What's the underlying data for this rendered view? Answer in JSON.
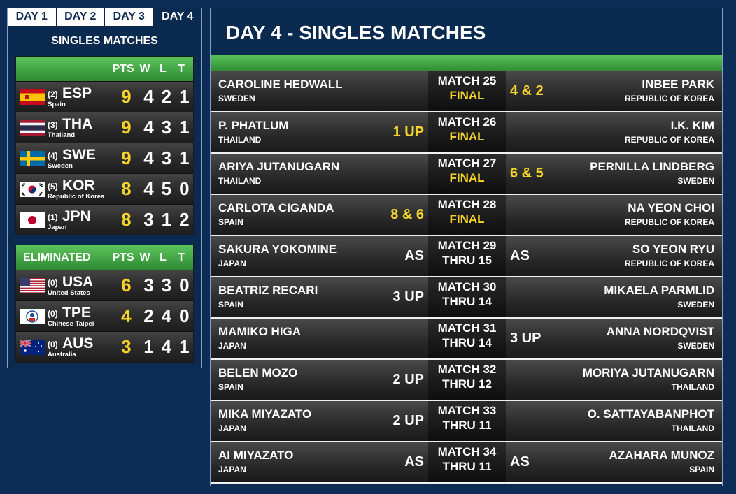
{
  "day_tabs": [
    {
      "label": "DAY 1",
      "active": false
    },
    {
      "label": "DAY 2",
      "active": false
    },
    {
      "label": "DAY 3",
      "active": false
    },
    {
      "label": "DAY 4",
      "active": true
    }
  ],
  "left_heading": "SINGLES MATCHES",
  "standings_header": {
    "label": "",
    "pts": "PTS",
    "w": "W",
    "l": "L",
    "t": "T"
  },
  "standings": [
    {
      "seed": "(2)",
      "abbr": "ESP",
      "country": "Spain",
      "pts": "9",
      "w": "4",
      "l": "2",
      "t": "1",
      "flag": "spain-flag"
    },
    {
      "seed": "(3)",
      "abbr": "THA",
      "country": "Thailand",
      "pts": "9",
      "w": "4",
      "l": "3",
      "t": "1",
      "flag": "thailand-flag"
    },
    {
      "seed": "(4)",
      "abbr": "SWE",
      "country": "Sweden",
      "pts": "9",
      "w": "4",
      "l": "3",
      "t": "1",
      "flag": "sweden-flag"
    },
    {
      "seed": "(5)",
      "abbr": "KOR",
      "country": "Republic of Korea",
      "pts": "8",
      "w": "4",
      "l": "5",
      "t": "0",
      "flag": "korea-flag"
    },
    {
      "seed": "(1)",
      "abbr": "JPN",
      "country": "Japan",
      "pts": "8",
      "w": "3",
      "l": "1",
      "t": "2",
      "flag": "japan-flag"
    }
  ],
  "eliminated_header": {
    "label": "ELIMINATED",
    "pts": "PTS",
    "w": "W",
    "l": "L",
    "t": "T"
  },
  "eliminated": [
    {
      "seed": "(0)",
      "abbr": "USA",
      "country": "United States",
      "pts": "6",
      "w": "3",
      "l": "3",
      "t": "0",
      "flag": "usa-flag"
    },
    {
      "seed": "(0)",
      "abbr": "TPE",
      "country": "Chinese Taipei",
      "pts": "4",
      "w": "2",
      "l": "4",
      "t": "0",
      "flag": "taipei-flag"
    },
    {
      "seed": "(0)",
      "abbr": "AUS",
      "country": "Australia",
      "pts": "3",
      "w": "1",
      "l": "4",
      "t": "1",
      "flag": "australia-flag"
    }
  ],
  "main_title": "DAY 4 - SINGLES MATCHES",
  "matches": [
    {
      "p1": "CAROLINE HEDWALL",
      "p1_country": "SWEDEN",
      "p2": "INBEE PARK",
      "p2_country": "REPUBLIC OF KOREA",
      "match": "MATCH 25",
      "status": "FINAL",
      "final": true,
      "score_left": "",
      "score_right": "4 & 2"
    },
    {
      "p1": "P. PHATLUM",
      "p1_country": "THAILAND",
      "p2": "I.K. KIM",
      "p2_country": "REPUBLIC OF KOREA",
      "match": "MATCH 26",
      "status": "FINAL",
      "final": true,
      "score_left": "1 UP",
      "score_right": ""
    },
    {
      "p1": "ARIYA JUTANUGARN",
      "p1_country": "THAILAND",
      "p2": "PERNILLA LINDBERG",
      "p2_country": "SWEDEN",
      "match": "MATCH 27",
      "status": "FINAL",
      "final": true,
      "score_left": "",
      "score_right": "6 & 5"
    },
    {
      "p1": "CARLOTA CIGANDA",
      "p1_country": "SPAIN",
      "p2": "NA YEON CHOI",
      "p2_country": "REPUBLIC OF KOREA",
      "match": "MATCH 28",
      "status": "FINAL",
      "final": true,
      "score_left": "8 & 6",
      "score_right": ""
    },
    {
      "p1": "SAKURA YOKOMINE",
      "p1_country": "JAPAN",
      "p2": "SO YEON RYU",
      "p2_country": "REPUBLIC OF KOREA",
      "match": "MATCH 29",
      "status": "THRU 15",
      "final": false,
      "score_left": "AS",
      "score_right": "AS"
    },
    {
      "p1": "BEATRIZ RECARI",
      "p1_country": "SPAIN",
      "p2": "MIKAELA PARMLID",
      "p2_country": "SWEDEN",
      "match": "MATCH 30",
      "status": "THRU 14",
      "final": false,
      "score_left": "3 UP",
      "score_right": ""
    },
    {
      "p1": "MAMIKO HIGA",
      "p1_country": "JAPAN",
      "p2": "ANNA NORDQVIST",
      "p2_country": "SWEDEN",
      "match": "MATCH 31",
      "status": "THRU 14",
      "final": false,
      "score_left": "",
      "score_right": "3 UP"
    },
    {
      "p1": "BELEN MOZO",
      "p1_country": "SPAIN",
      "p2": "MORIYA JUTANUGARN",
      "p2_country": "THAILAND",
      "match": "MATCH 32",
      "status": "THRU 12",
      "final": false,
      "score_left": "2 UP",
      "score_right": ""
    },
    {
      "p1": "MIKA MIYAZATO",
      "p1_country": "JAPAN",
      "p2": "O. SATTAYABANPHOT",
      "p2_country": "THAILAND",
      "match": "MATCH 33",
      "status": "THRU 11",
      "final": false,
      "score_left": "2 UP",
      "score_right": ""
    },
    {
      "p1": "AI MIYAZATO",
      "p1_country": "JAPAN",
      "p2": "AZAHARA MUNOZ",
      "p2_country": "SPAIN",
      "match": "MATCH 34",
      "status": "THRU 11",
      "final": false,
      "score_left": "AS",
      "score_right": "AS"
    }
  ]
}
